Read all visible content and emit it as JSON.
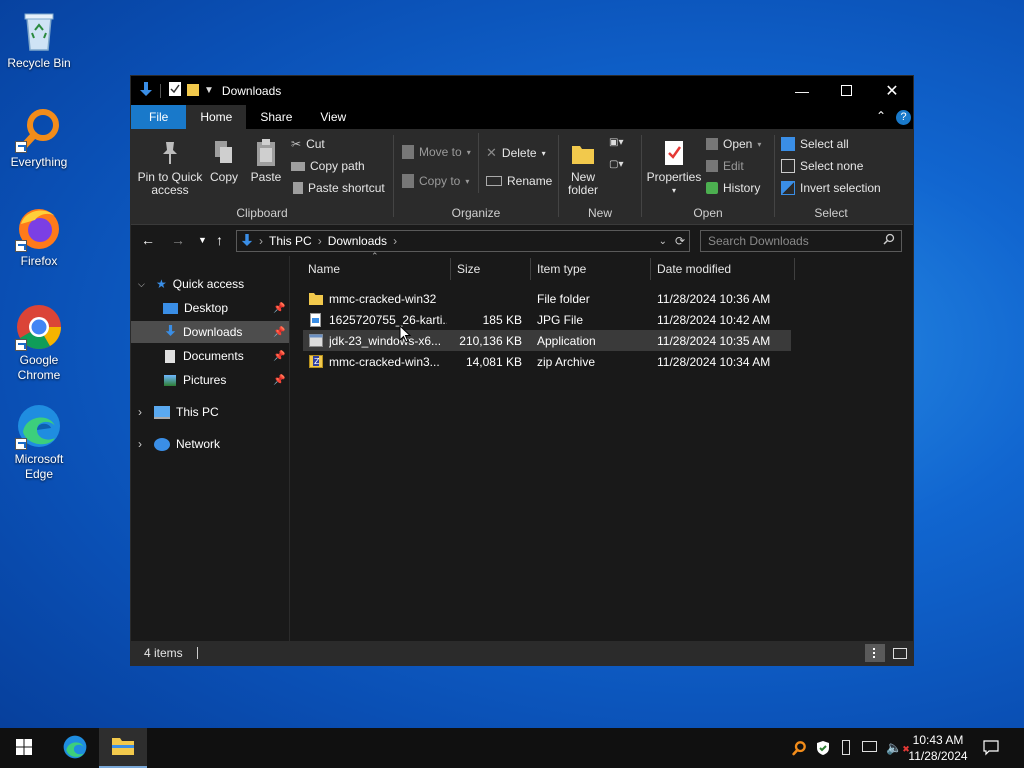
{
  "desktop": {
    "icons": [
      {
        "label": "Recycle Bin",
        "icon": "recycle-bin-icon"
      },
      {
        "label": "Everything",
        "icon": "everything-search-icon"
      },
      {
        "label": "Firefox",
        "icon": "firefox-icon"
      },
      {
        "label": "Google Chrome",
        "icon": "chrome-icon"
      },
      {
        "label": "Microsoft Edge",
        "icon": "edge-icon"
      }
    ]
  },
  "window": {
    "title": "Downloads",
    "tabs": [
      "File",
      "Home",
      "Share",
      "View"
    ],
    "active_tab": "Home",
    "ribbon": {
      "clipboard": {
        "label": "Clipboard",
        "pin": "Pin to Quick access",
        "copy": "Copy",
        "paste": "Paste",
        "cut": "Cut",
        "copy_path": "Copy path",
        "paste_shortcut": "Paste shortcut"
      },
      "organize": {
        "label": "Organize",
        "move_to": "Move to",
        "copy_to": "Copy to",
        "delete": "Delete",
        "rename": "Rename"
      },
      "new": {
        "label": "New",
        "new_folder": "New folder"
      },
      "open": {
        "label": "Open",
        "properties": "Properties",
        "open": "Open",
        "edit": "Edit",
        "history": "History"
      },
      "select": {
        "label": "Select",
        "select_all": "Select all",
        "select_none": "Select none",
        "invert": "Invert selection"
      }
    },
    "address": {
      "crumbs": [
        "This PC",
        "Downloads"
      ],
      "search_placeholder": "Search Downloads"
    },
    "nav": {
      "quick_access": "Quick access",
      "desktop": "Desktop",
      "downloads": "Downloads",
      "documents": "Documents",
      "pictures": "Pictures",
      "this_pc": "This PC",
      "network": "Network"
    },
    "columns": [
      "Name",
      "Size",
      "Item type",
      "Date modified"
    ],
    "files": [
      {
        "name": "mmc-cracked-win32",
        "size": "",
        "type": "File folder",
        "date": "11/28/2024 10:36 AM",
        "icon": "folder-icon"
      },
      {
        "name": "1625720755_26-karti...",
        "size": "185 KB",
        "type": "JPG File",
        "date": "11/28/2024 10:42 AM",
        "icon": "image-file-icon"
      },
      {
        "name": "jdk-23_windows-x6...",
        "size": "210,136 KB",
        "type": "Application",
        "date": "11/28/2024 10:35 AM",
        "icon": "application-icon"
      },
      {
        "name": "mmc-cracked-win3...",
        "size": "14,081 KB",
        "type": "zip Archive",
        "date": "11/28/2024 10:34 AM",
        "icon": "zip-archive-icon"
      }
    ],
    "status": "4 items"
  },
  "taskbar": {
    "time": "10:43 AM",
    "date": "11/28/2024"
  },
  "colors": {
    "accent": "#1979ca",
    "window_bg": "#191919",
    "ribbon_bg": "#2b2b2b",
    "folder": "#f2c94c",
    "selection": "#4d4d4d"
  }
}
